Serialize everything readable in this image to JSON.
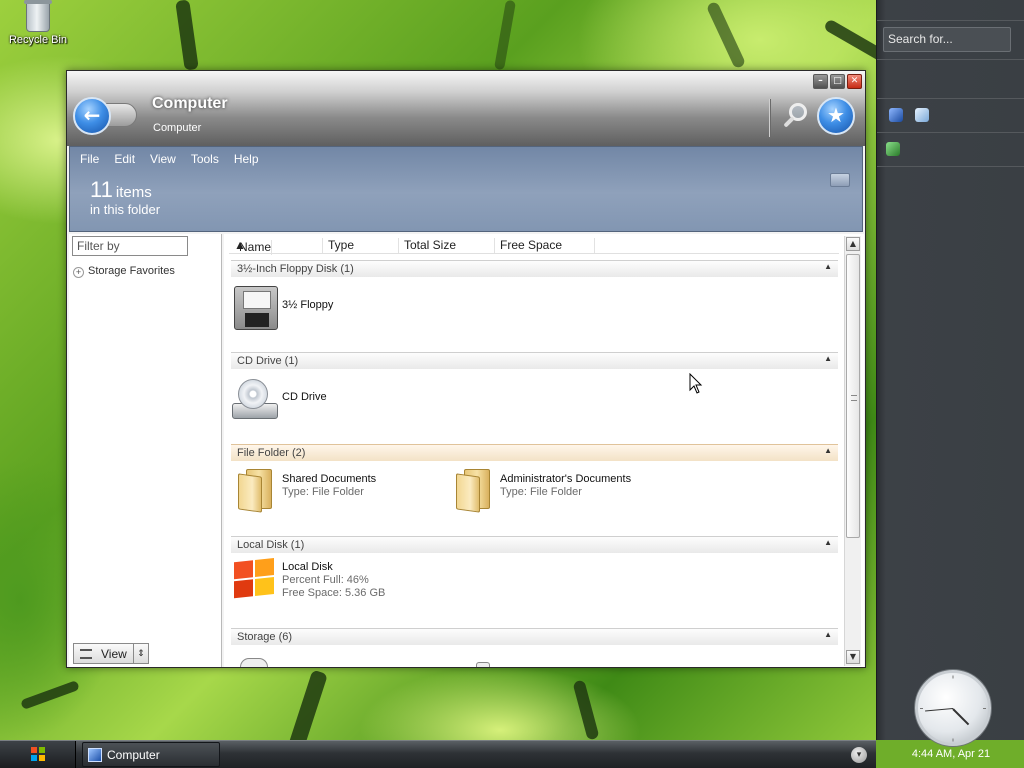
{
  "desktop": {
    "recycle_bin_label": "Recycle Bin"
  },
  "sidebar": {
    "search_placeholder": "Search for...",
    "clock_label": "4:44 AM, Apr 21"
  },
  "taskbar": {
    "task_item_label": "Computer"
  },
  "window": {
    "title": "Computer",
    "subtitle": "Computer",
    "controls": [
      "minimize",
      "maximize",
      "close"
    ],
    "menu": [
      "File",
      "Edit",
      "View",
      "Tools",
      "Help"
    ],
    "items_count": "11",
    "items_word": "items",
    "items_sub": "in this folder"
  },
  "leftpane": {
    "filter_placeholder": "Filter by",
    "favorites_label": "Storage Favorites",
    "view_button_label": "View"
  },
  "columns": [
    "Name",
    "Type",
    "Total Size",
    "Free Space"
  ],
  "groups": [
    {
      "header": "3½-Inch Floppy Disk (1)",
      "items": [
        {
          "name": "3½ Floppy",
          "icon": "floppy-disk-icon"
        }
      ]
    },
    {
      "header": "CD Drive (1)",
      "items": [
        {
          "name": "CD Drive",
          "icon": "cd-drive-icon"
        }
      ]
    },
    {
      "header": "File Folder (2)",
      "items": [
        {
          "name": "Shared Documents",
          "detail": "Type: File Folder",
          "icon": "folder-icon"
        },
        {
          "name": "Administrator's Documents",
          "detail": "Type: File Folder",
          "icon": "folder-icon"
        }
      ]
    },
    {
      "header": "Local Disk (1)",
      "items": [
        {
          "name": "Local Disk",
          "detail": "Percent Full: 46%",
          "detail2": "Free Space: 5.36 GB",
          "icon": "local-disk-icon",
          "percent_full": 46
        }
      ]
    },
    {
      "header": "Storage (6)",
      "items": []
    }
  ]
}
